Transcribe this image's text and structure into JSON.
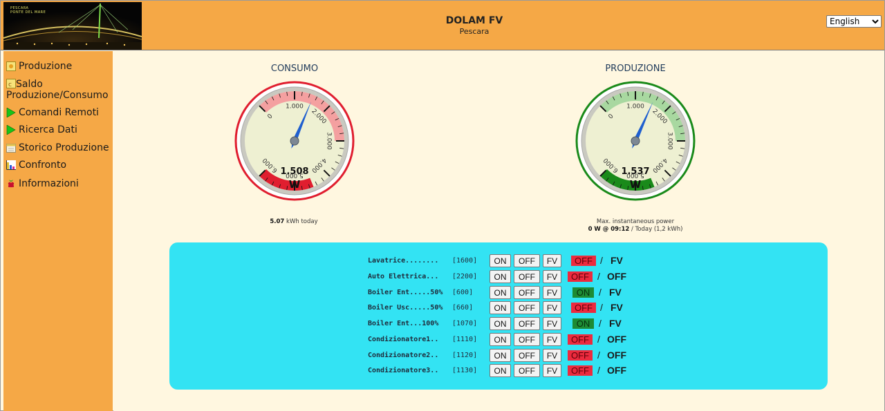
{
  "header": {
    "title": "DOLAM FV",
    "subtitle": "Pescara",
    "logo_text_line1": "PESCARA",
    "logo_text_line2": "PONTE DEL MARE",
    "language": "English"
  },
  "sidebar": {
    "items": [
      {
        "label": "Produzione",
        "icon": "sun-panel-icon"
      },
      {
        "label": "Saldo Produzione/Consumo",
        "icon": "balance-icon"
      },
      {
        "label": "Comandi Remoti",
        "icon": "play-arrow-icon"
      },
      {
        "label": "Ricerca Dati",
        "icon": "play-arrow-icon"
      },
      {
        "label": "Storico Produzione",
        "icon": "calendar-icon"
      },
      {
        "label": "Confronto",
        "icon": "bar-chart-icon"
      },
      {
        "label": "Informazioni",
        "icon": "raspberry-icon"
      }
    ]
  },
  "gauges": {
    "consumo": {
      "title": "CONSUMO",
      "value_text": "1.508",
      "value": 1508,
      "unit": "W",
      "max": 6000,
      "color": "#e01e2f",
      "ticks": [
        "0",
        "1.000",
        "2.000",
        "3.000",
        "4.000",
        "5.000",
        "6.000"
      ],
      "caption_value": "5.07",
      "caption_rest": " kWh today"
    },
    "produzione": {
      "title": "PRODUZIONE",
      "value_text": "1.537",
      "value": 1537,
      "unit": "W",
      "max": 6000,
      "color": "#1a8a1a",
      "ticks": [
        "0",
        "1.000",
        "2.000",
        "3.000",
        "4.000",
        "5.000",
        "6.000"
      ],
      "caption_line1": "Max. instantaneous power",
      "caption_max": "0 W @ 09:12",
      "caption_rest": " / Today (1,2 kWh)"
    }
  },
  "controls": {
    "on_label": "ON",
    "off_label": "OFF",
    "fv_label": "FV",
    "separator": "/",
    "devices": [
      {
        "name": "Lavatrice........",
        "power": "[1600]",
        "status": "OFF",
        "mode": "FV"
      },
      {
        "name": "Auto Elettrica...",
        "power": "[2200]",
        "status": "OFF",
        "mode": "OFF"
      },
      {
        "name": "Boiler Ent.....50%",
        "power": "[600]",
        "status": "ON",
        "mode": "FV"
      },
      {
        "name": "Boiler Usc.....50%",
        "power": "[660]",
        "status": "OFF",
        "mode": "FV"
      },
      {
        "name": "Boiler Ent...100%",
        "power": "[1070]",
        "status": "ON",
        "mode": "FV"
      },
      {
        "name": "Condizionatore1..",
        "power": "[1110]",
        "status": "OFF",
        "mode": "OFF"
      },
      {
        "name": "Condizionatore2..",
        "power": "[1120]",
        "status": "OFF",
        "mode": "OFF"
      },
      {
        "name": "Condizionatore3..",
        "power": "[1130]",
        "status": "OFF",
        "mode": "OFF"
      }
    ]
  }
}
